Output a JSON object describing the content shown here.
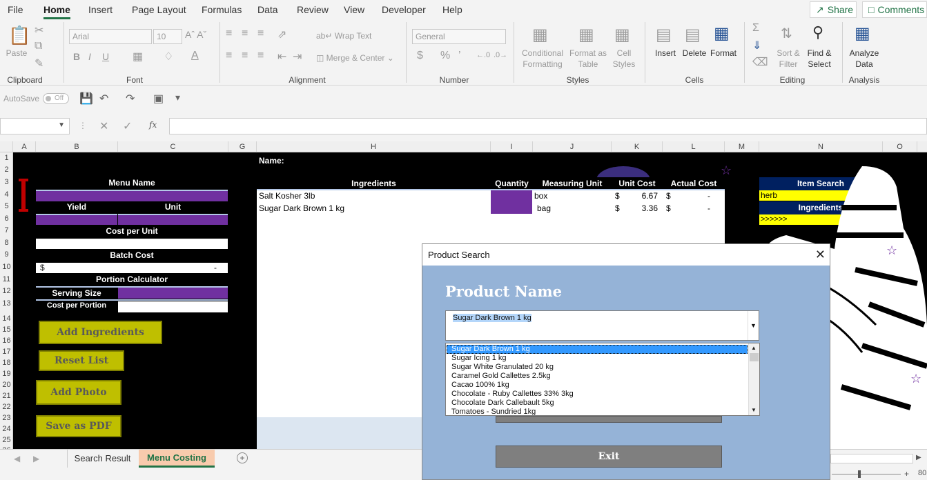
{
  "ribbon_tabs": [
    "File",
    "Home",
    "Insert",
    "Page Layout",
    "Formulas",
    "Data",
    "Review",
    "View",
    "Developer",
    "Help"
  ],
  "active_tab": "Home",
  "share_label": "Share",
  "comments_label": "Comments",
  "ribbon": {
    "paste": "Paste",
    "font_name": "Arial",
    "font_size": "10",
    "wrap_text": "Wrap Text",
    "merge_center": "Merge & Center",
    "number_format": "General",
    "conditional_formatting": [
      "Conditional",
      "Formatting"
    ],
    "format_as_table": [
      "Format as",
      "Table"
    ],
    "cell_styles": [
      "Cell",
      "Styles"
    ],
    "insert": "Insert",
    "delete": "Delete",
    "format": "Format",
    "sort_filter": [
      "Sort &",
      "Filter"
    ],
    "find_select": [
      "Find &",
      "Select"
    ],
    "analyze_data": [
      "Analyze",
      "Data"
    ],
    "groups": [
      "Clipboard",
      "Font",
      "Alignment",
      "Number",
      "Styles",
      "Cells",
      "Editing",
      "Analysis"
    ]
  },
  "qat": {
    "autosave": "AutoSave",
    "toggle": "Off"
  },
  "formula_bar": {
    "name_box": "",
    "fx": "fx",
    "formula": ""
  },
  "columns": [
    "A",
    "B",
    "C",
    "G",
    "H",
    "I",
    "J",
    "K",
    "L",
    "M",
    "N",
    "O"
  ],
  "rows": [
    "1",
    "2",
    "3",
    "4",
    "5",
    "6",
    "7",
    "8",
    "9",
    "10",
    "11",
    "12",
    "13",
    "14",
    "15",
    "16",
    "17",
    "18",
    "19",
    "20",
    "21",
    "22",
    "23",
    "24",
    "25",
    "26"
  ],
  "left_panel": {
    "menu_name": "Menu Name",
    "yield": "Yield",
    "unit": "Unit",
    "cost_per_unit": "Cost per Unit",
    "batch_cost": "Batch Cost",
    "batch_currency": "$",
    "batch_value": "-",
    "portion_calculator": "Portion Calculator",
    "serving_size": "Serving Size",
    "cost_per_portion": "Cost per Portion"
  },
  "buttons": {
    "add_ingredients": "Add Ingredients",
    "reset_list": "Reset List",
    "add_photo": "Add Photo",
    "save_pdf": "Save as PDF"
  },
  "table": {
    "name_label": "Name:",
    "headers": [
      "Ingredients",
      "Quantity",
      "Measuring Unit",
      "Unit Cost",
      "Actual Cost"
    ],
    "rows": [
      {
        "ingredient": "Salt Kosher 3lb",
        "unit": "box",
        "cur": "$",
        "unit_cost": "6.67",
        "cur2": "$",
        "actual": "-"
      },
      {
        "ingredient": "Sugar Dark Brown 1 kg",
        "unit": "bag",
        "cur": "$",
        "unit_cost": "3.36",
        "cur2": "$",
        "actual": "-"
      }
    ]
  },
  "search_panel": {
    "item_search": "Item Search",
    "search_value": "herb",
    "ingredients": "Ingredients",
    "arrows": ">>>>>>"
  },
  "sheet_tabs": [
    "Search Result",
    "Menu Costing"
  ],
  "active_sheet": "Menu Costing",
  "status": {
    "zoom": "80"
  },
  "dialog": {
    "title": "Product Search",
    "heading": "Product Name",
    "selected": "Sugar Dark Brown 1 kg",
    "list": [
      "Sugar Dark Brown 1 kg",
      "Sugar Icing 1 kg",
      "Sugar White Granulated 20 kg",
      "Caramel Gold Callettes 2.5kg",
      "Cacao 100% 1kg",
      "Chocolate - Ruby Callettes 33%  3kg",
      "Chocolate Dark Callebault 5kg",
      "Tomatoes - Sundried 1kg"
    ],
    "exit": "Exit"
  },
  "colors": {
    "purple": "#7030a0",
    "navy": "#002060",
    "yellow": "#ffff00",
    "olive": "#bfbf00",
    "dialog_bg": "#95b3d7",
    "excel_green": "#217346"
  }
}
